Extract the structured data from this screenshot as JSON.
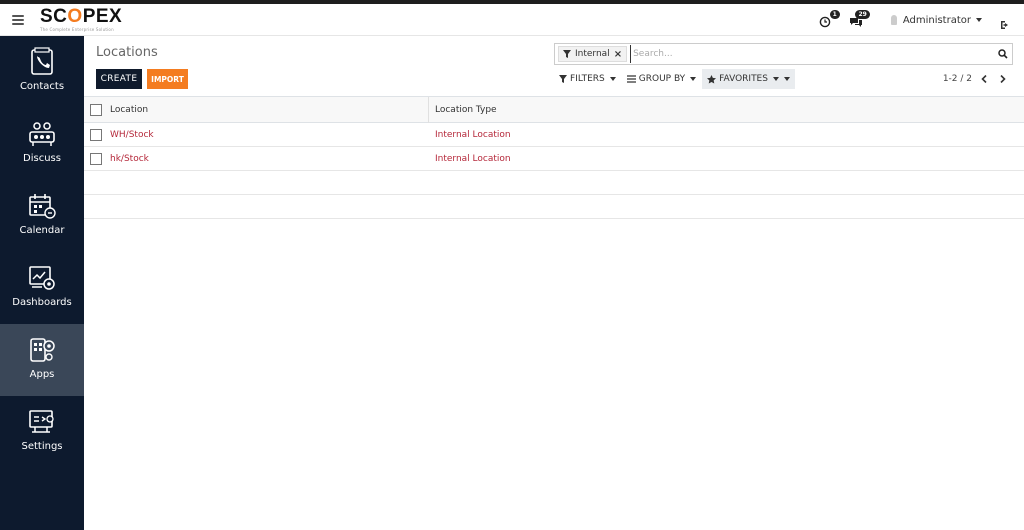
{
  "brand": {
    "logo_prefix": "SC",
    "logo_o": "O",
    "logo_suffix": "PEX",
    "tagline": "The Complete Enterprise Solution",
    "accent": "#f47c20"
  },
  "topbar": {
    "activity_count": "1",
    "messages_count": "29",
    "user_name": "Administrator"
  },
  "sidebar": {
    "items": [
      {
        "label": "Contacts",
        "icon": "contacts-icon"
      },
      {
        "label": "Discuss",
        "icon": "discuss-icon"
      },
      {
        "label": "Calendar",
        "icon": "calendar-icon"
      },
      {
        "label": "Dashboards",
        "icon": "dashboards-icon"
      },
      {
        "label": "Apps",
        "icon": "apps-icon",
        "active": true
      },
      {
        "label": "Settings",
        "icon": "settings-icon"
      }
    ]
  },
  "control_panel": {
    "title": "Locations",
    "create_label": "CREATE",
    "import_label": "IMPORT",
    "search": {
      "facet": "Internal",
      "placeholder": "Search..."
    },
    "filters_label": "FILTERS",
    "group_by_label": "GROUP BY",
    "favorites_label": "FAVORITES",
    "pager": "1-2 / 2"
  },
  "table": {
    "columns": [
      "Location",
      "Location Type"
    ],
    "rows": [
      {
        "location": "WH/Stock",
        "type": "Internal Location"
      },
      {
        "location": "hk/Stock",
        "type": "Internal Location"
      }
    ]
  }
}
